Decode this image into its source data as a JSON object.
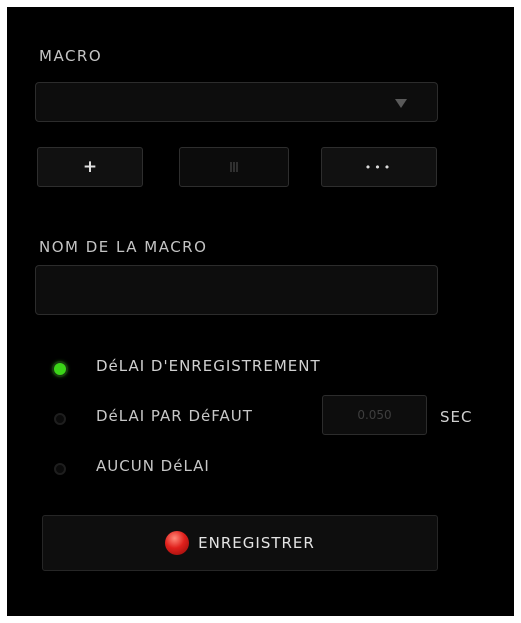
{
  "macro": {
    "label": "MACRO",
    "dropdown_value": "",
    "dropdown_icon": "triangle-down-icon",
    "add_label": "+",
    "more_label": "•••"
  },
  "macro_name": {
    "label": "NOM DE LA MACRO",
    "value": ""
  },
  "delay": {
    "options": [
      {
        "label": "DéLAI D'ENREGISTREMENT",
        "selected": true
      },
      {
        "label": "DéLAI PAR DéFAUT",
        "selected": false
      },
      {
        "label": "AUCUN DéLAI",
        "selected": false
      }
    ],
    "default_value": "0.050",
    "unit": "SEC"
  },
  "record": {
    "label": "ENREGISTRER",
    "icon": "record-dot-icon"
  },
  "colors": {
    "background": "#000000",
    "selected_radio": "#3bd418",
    "record_dot": "#e0201c"
  }
}
